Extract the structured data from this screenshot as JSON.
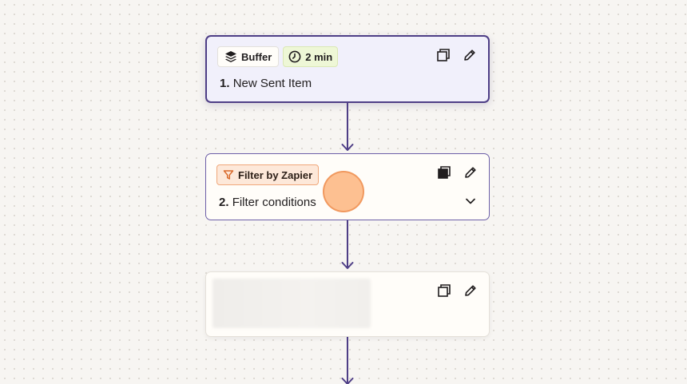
{
  "steps": [
    {
      "app_badge": {
        "label": "Buffer",
        "icon": "buffer-stack-icon"
      },
      "time_badge": {
        "label": "2 min",
        "icon": "clock-icon"
      },
      "number": "1.",
      "title": "New Sent Item"
    },
    {
      "app_badge": {
        "label": "Filter by Zapier",
        "icon": "filter-funnel-icon"
      },
      "number": "2.",
      "title": "Filter conditions"
    },
    {
      "placeholder": true
    }
  ],
  "colors": {
    "accent": "#4e3e86",
    "filter_badge_bg": "#fde8d9",
    "time_badge_bg": "#eef7d6",
    "click_marker": "#fcb27a"
  }
}
